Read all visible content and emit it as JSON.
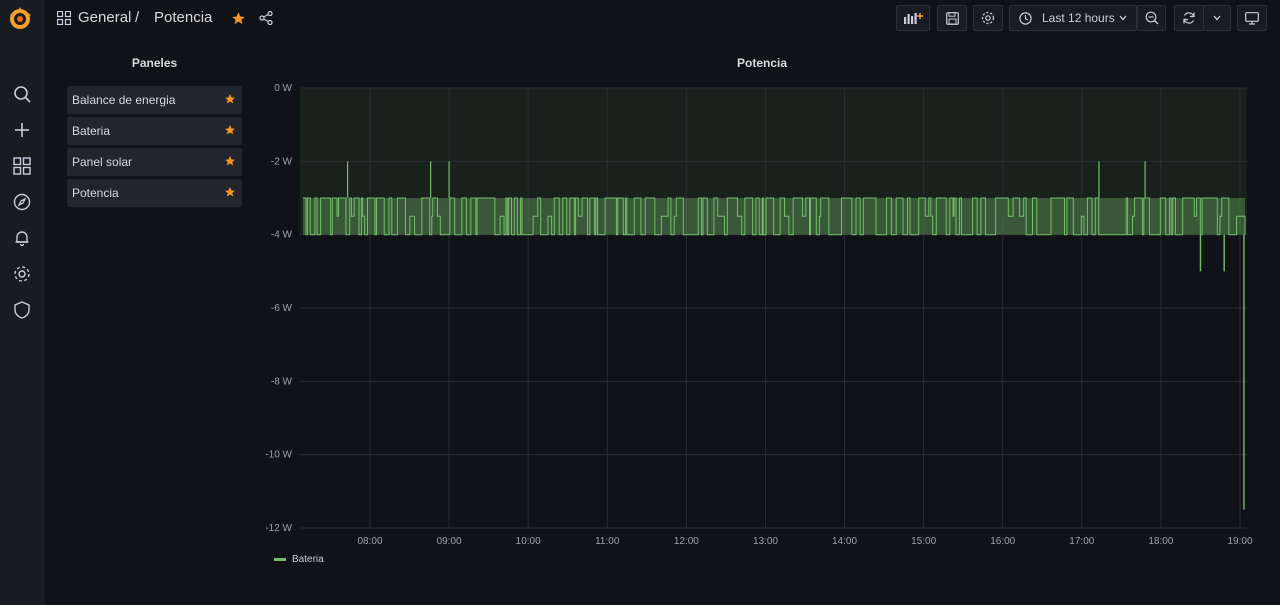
{
  "colors": {
    "accent": "#f79520",
    "series": "#73bf69",
    "background": "#111217",
    "grid": "#2a2c31",
    "muted": "#9fa0a6"
  },
  "breadcrumb": {
    "folder": "General",
    "separator": "/",
    "dashboard": "Potencia"
  },
  "toolbar": {
    "time_range": "Last 12 hours"
  },
  "sidebar": {
    "icons": [
      "search-icon",
      "plus-icon",
      "dashboards-icon",
      "explore-icon",
      "alerting-icon",
      "configuration-icon",
      "shield-icon"
    ]
  },
  "panels_list": {
    "title": "Paneles",
    "items": [
      {
        "label": "Balance de energia"
      },
      {
        "label": "Bateria"
      },
      {
        "label": "Panel solar"
      },
      {
        "label": "Potencia"
      }
    ]
  },
  "chart_data": {
    "type": "line",
    "title": "Potencia",
    "ylabel": "",
    "xlabel": "",
    "ylim": [
      -12,
      0
    ],
    "y_ticks": [
      "0 W",
      "-2 W",
      "-4 W",
      "-6 W",
      "-8 W",
      "-10 W",
      "-12 W"
    ],
    "x_ticks": [
      "08:00",
      "09:00",
      "10:00",
      "11:00",
      "12:00",
      "13:00",
      "14:00",
      "15:00",
      "16:00",
      "17:00",
      "18:00",
      "19:00"
    ],
    "threshold_band": [
      -4,
      0
    ],
    "grid": true,
    "legend_position": "bottom-left",
    "series": [
      {
        "name": "Bateria",
        "typical_range": [
          -4,
          -3
        ],
        "spikes_up": [
          [
            "07:43",
            -2.0
          ],
          [
            "08:46",
            -2.0
          ],
          [
            "09:00",
            -2.0
          ],
          [
            "17:13",
            -2.0
          ],
          [
            "17:48",
            -2.0
          ]
        ],
        "late_dips": [
          [
            "18:30",
            -5.0
          ],
          [
            "18:48",
            -5.0
          ],
          [
            "19:03",
            -11.5
          ]
        ]
      }
    ]
  }
}
